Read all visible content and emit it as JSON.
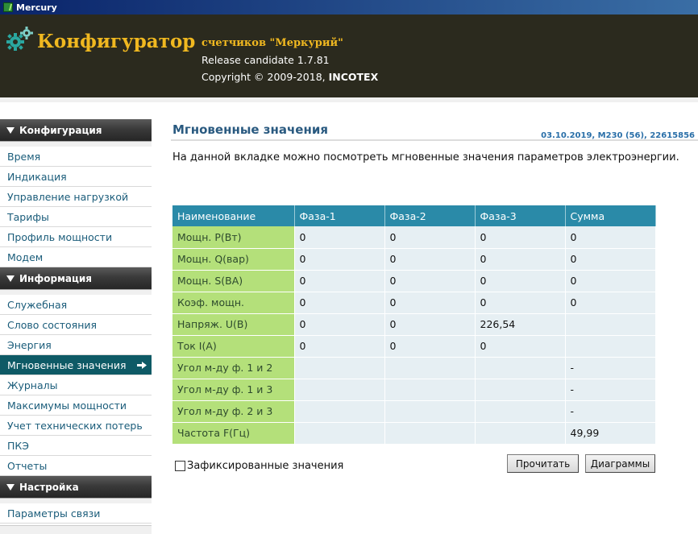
{
  "window": {
    "title": "Mercury"
  },
  "header": {
    "brand": "Конфигуратор",
    "subtitle": "счетчиков \"Меркурий\"",
    "release": "Release candidate 1.7.81",
    "copyright_prefix": "Copyright © 2009-2018, ",
    "copyright_company": "INCOTEX"
  },
  "sidebar": {
    "sections": [
      {
        "title": "Конфигурация",
        "items": [
          "Время",
          "Индикация",
          "Управление нагрузкой",
          "Тарифы",
          "Профиль мощности",
          "Модем"
        ]
      },
      {
        "title": "Информация",
        "items": [
          "Служебная",
          "Слово состояния",
          "Энергия",
          "Мгновенные значения",
          "Журналы",
          "Максимумы мощности",
          "Учет технических потерь",
          "ПКЭ",
          "Отчеты"
        ]
      },
      {
        "title": "Настройка",
        "items": [
          "Параметры связи"
        ]
      }
    ],
    "active_item": "Мгновенные значения"
  },
  "main": {
    "title": "Мгновенные значения",
    "device_info": "03.10.2019, M230 (56), 22615856",
    "description": "На данной вкладке можно посмотреть мгновенные значения параметров электроэнергии.",
    "table": {
      "headers": [
        "Наименование",
        "Фаза-1",
        "Фаза-2",
        "Фаза-3",
        "Сумма"
      ],
      "rows": [
        [
          "Мощн. P(Вт)",
          "0",
          "0",
          "0",
          "0"
        ],
        [
          "Мощн. Q(вар)",
          "0",
          "0",
          "0",
          "0"
        ],
        [
          "Мощн. S(ВА)",
          "0",
          "0",
          "0",
          "0"
        ],
        [
          "Коэф. мощн.",
          "0",
          "0",
          "0",
          "0"
        ],
        [
          "Напряж. U(В)",
          "0",
          "0",
          "226,54",
          ""
        ],
        [
          "Ток I(A)",
          "0",
          "0",
          "0",
          ""
        ],
        [
          "Угол м-ду ф. 1 и 2",
          "",
          "",
          "",
          "-"
        ],
        [
          "Угол м-ду ф. 1 и 3",
          "",
          "",
          "",
          "-"
        ],
        [
          "Угол м-ду ф. 2 и 3",
          "",
          "",
          "",
          "-"
        ],
        [
          "Частота F(Гц)",
          "",
          "",
          "",
          "49,99"
        ]
      ]
    },
    "fixed_values_label": "Зафиксированные значения",
    "fixed_values_checked": false,
    "buttons": {
      "read": "Прочитать",
      "charts": "Диаграммы"
    }
  },
  "colors": {
    "header_bg": "#2b2a1e",
    "brand": "#f0b820",
    "table_header": "#2a8aa8",
    "name_cell": "#b4e07a",
    "value_cell": "#e6eff3",
    "nav_active": "#0e5a66",
    "nav_text": "#1a5c7a"
  }
}
